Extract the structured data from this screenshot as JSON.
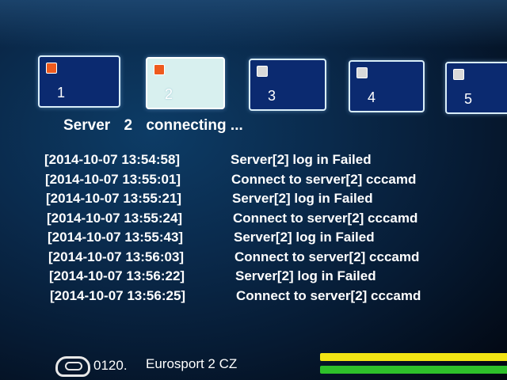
{
  "server_tabs": [
    {
      "number": "1",
      "status": "active"
    },
    {
      "number": "2",
      "status": "active",
      "selected": true
    },
    {
      "number": "3",
      "status": "inactive"
    },
    {
      "number": "4",
      "status": "inactive"
    },
    {
      "number": "5",
      "status": "inactive"
    }
  ],
  "status": {
    "label": "Server",
    "server_number": "2",
    "state": "connecting ..."
  },
  "log": [
    {
      "time": "[2014-10-07   13:54:58]",
      "message": "Server[2] log in Failed"
    },
    {
      "time": "[2014-10-07   13:55:01]",
      "message": "Connect to server[2] cccamd"
    },
    {
      "time": "[2014-10-07   13:55:21]",
      "message": "Server[2] log in Failed"
    },
    {
      "time": "[2014-10-07   13:55:24]",
      "message": "Connect to server[2] cccamd"
    },
    {
      "time": "[2014-10-07   13:55:43]",
      "message": "Server[2] log in Failed"
    },
    {
      "time": "[2014-10-07   13:56:03]",
      "message": "Connect to server[2] cccamd"
    },
    {
      "time": "[2014-10-07   13:56:22]",
      "message": "Server[2] log in Failed"
    },
    {
      "time": "[2014-10-07   13:56:25]",
      "message": "Connect to server[2] cccamd"
    }
  ],
  "channel": {
    "icon": "tv-icon",
    "number": "0120.",
    "name": "Eurosport 2 CZ"
  },
  "colors": {
    "active_status": "#ee5a1e",
    "inactive_status": "#d9d9d9",
    "signal_strength": "#f2e414",
    "signal_quality": "#2ec02a"
  }
}
